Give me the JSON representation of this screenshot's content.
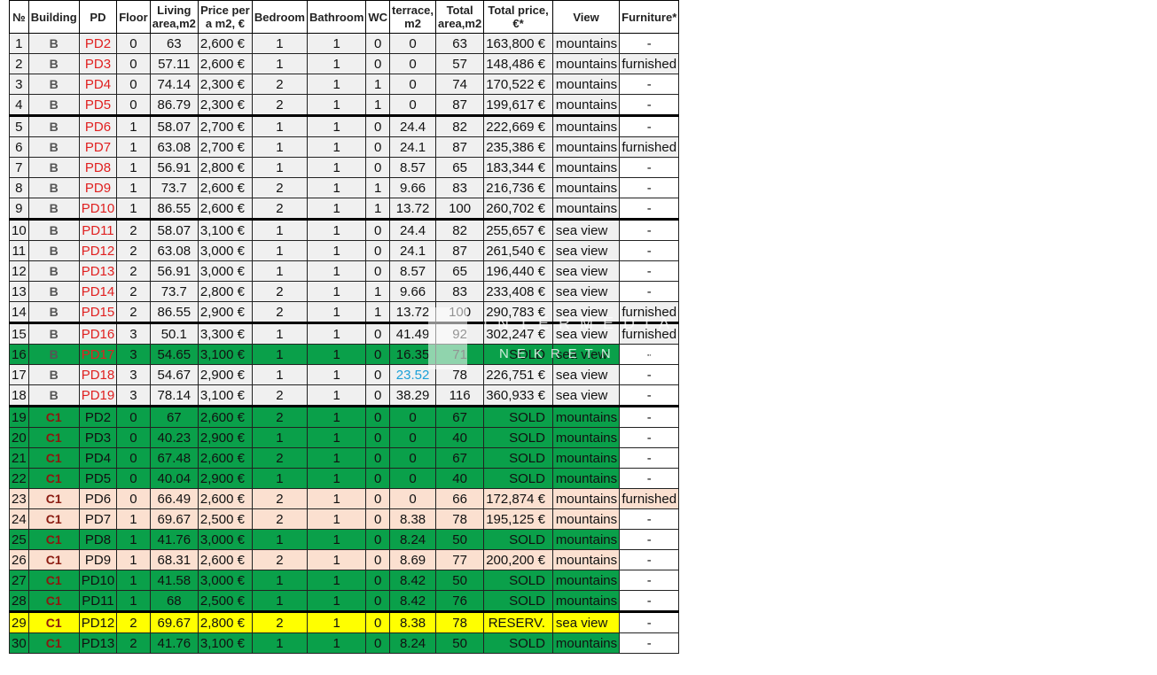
{
  "headers": [
    "№",
    "Building",
    "PD",
    "Floor",
    "Living area,m2",
    "Price per a m2, €",
    "Bedroom",
    "Bathroom",
    "WC",
    "terrace, m2",
    "Total area,m2",
    "Total price, €*",
    "View",
    "Furniture*"
  ],
  "watermark": {
    "line1": "INTERMEDIA",
    "line2": "NEKRETNINE"
  },
  "colors": {
    "sold_green": "#0aa04a",
    "reserved_yellow": "#ffff00",
    "furnished_orange": "#ffb31c",
    "peach": "#fbe0d0",
    "grey": "#f0f0f0",
    "pd_red": "#e02020",
    "terrace_blue": "#1aa0d8"
  },
  "rows": [
    {
      "no": "1",
      "building": "B",
      "pd": "PD2",
      "floor": "0",
      "living": "63",
      "ppm": "2,600 €",
      "bed": "1",
      "bath": "1",
      "wc": "0",
      "terrace": "0",
      "total_area": "63",
      "total_price": "163,800 €",
      "view": "mountains",
      "furniture": "-",
      "style": "grey",
      "pd_red": true,
      "furn_hi": false
    },
    {
      "no": "2",
      "building": "B",
      "pd": "PD3",
      "floor": "0",
      "living": "57.11",
      "ppm": "2,600 €",
      "bed": "1",
      "bath": "1",
      "wc": "0",
      "terrace": "0",
      "total_area": "57",
      "total_price": "148,486 €",
      "view": "mountains",
      "furniture": "furnished",
      "style": "grey",
      "pd_red": true,
      "furn_hi": true
    },
    {
      "no": "3",
      "building": "B",
      "pd": "PD4",
      "floor": "0",
      "living": "74.14",
      "ppm": "2,300 €",
      "bed": "2",
      "bath": "1",
      "wc": "1",
      "terrace": "0",
      "total_area": "74",
      "total_price": "170,522 €",
      "view": "mountains",
      "furniture": "-",
      "style": "grey",
      "pd_red": true,
      "furn_hi": false
    },
    {
      "no": "4",
      "building": "B",
      "pd": "PD5",
      "floor": "0",
      "living": "86.79",
      "ppm": "2,300 €",
      "bed": "2",
      "bath": "1",
      "wc": "1",
      "terrace": "0",
      "total_area": "87",
      "total_price": "199,617 €",
      "view": "mountains",
      "furniture": "-",
      "style": "grey",
      "pd_red": true,
      "furn_hi": false
    },
    {
      "no": "5",
      "building": "B",
      "pd": "PD6",
      "floor": "1",
      "living": "58.07",
      "ppm": "2,700 €",
      "bed": "1",
      "bath": "1",
      "wc": "0",
      "terrace": "24.4",
      "total_area": "82",
      "total_price": "222,669 €",
      "view": "mountains",
      "furniture": "-",
      "style": "grey",
      "pd_red": true,
      "furn_hi": false,
      "thick": true
    },
    {
      "no": "6",
      "building": "B",
      "pd": "PD7",
      "floor": "1",
      "living": "63.08",
      "ppm": "2,700 €",
      "bed": "1",
      "bath": "1",
      "wc": "0",
      "terrace": "24.1",
      "total_area": "87",
      "total_price": "235,386 €",
      "view": "mountains",
      "furniture": "furnished",
      "style": "grey",
      "pd_red": true,
      "furn_hi": true
    },
    {
      "no": "7",
      "building": "B",
      "pd": "PD8",
      "floor": "1",
      "living": "56.91",
      "ppm": "2,800 €",
      "bed": "1",
      "bath": "1",
      "wc": "0",
      "terrace": "8.57",
      "total_area": "65",
      "total_price": "183,344 €",
      "view": "mountains",
      "furniture": "-",
      "style": "grey",
      "pd_red": true,
      "furn_hi": false
    },
    {
      "no": "8",
      "building": "B",
      "pd": "PD9",
      "floor": "1",
      "living": "73.7",
      "ppm": "2,600 €",
      "bed": "2",
      "bath": "1",
      "wc": "1",
      "terrace": "9.66",
      "total_area": "83",
      "total_price": "216,736 €",
      "view": "mountains",
      "furniture": "-",
      "style": "grey",
      "pd_red": true,
      "furn_hi": false
    },
    {
      "no": "9",
      "building": "B",
      "pd": "PD10",
      "floor": "1",
      "living": "86.55",
      "ppm": "2,600 €",
      "bed": "2",
      "bath": "1",
      "wc": "1",
      "terrace": "13.72",
      "total_area": "100",
      "total_price": "260,702 €",
      "view": "mountains",
      "furniture": "-",
      "style": "grey",
      "pd_red": true,
      "furn_hi": false
    },
    {
      "no": "10",
      "building": "B",
      "pd": "PD11",
      "floor": "2",
      "living": "58.07",
      "ppm": "3,100 €",
      "bed": "1",
      "bath": "1",
      "wc": "0",
      "terrace": "24.4",
      "total_area": "82",
      "total_price": "255,657 €",
      "view": "sea view",
      "furniture": "-",
      "style": "grey",
      "pd_red": true,
      "furn_hi": false,
      "thick": true
    },
    {
      "no": "11",
      "building": "B",
      "pd": "PD12",
      "floor": "2",
      "living": "63.08",
      "ppm": "3,000 €",
      "bed": "1",
      "bath": "1",
      "wc": "0",
      "terrace": "24.1",
      "total_area": "87",
      "total_price": "261,540 €",
      "view": "sea view",
      "furniture": "-",
      "style": "grey",
      "pd_red": true,
      "furn_hi": false
    },
    {
      "no": "12",
      "building": "B",
      "pd": "PD13",
      "floor": "2",
      "living": "56.91",
      "ppm": "3,000 €",
      "bed": "1",
      "bath": "1",
      "wc": "0",
      "terrace": "8.57",
      "total_area": "65",
      "total_price": "196,440 €",
      "view": "sea view",
      "furniture": "-",
      "style": "grey",
      "pd_red": true,
      "furn_hi": false
    },
    {
      "no": "13",
      "building": "B",
      "pd": "PD14",
      "floor": "2",
      "living": "73.7",
      "ppm": "2,800 €",
      "bed": "2",
      "bath": "1",
      "wc": "1",
      "terrace": "9.66",
      "total_area": "83",
      "total_price": "233,408 €",
      "view": "sea view",
      "furniture": "-",
      "style": "grey",
      "pd_red": true,
      "furn_hi": false
    },
    {
      "no": "14",
      "building": "B",
      "pd": "PD15",
      "floor": "2",
      "living": "86.55",
      "ppm": "2,900 €",
      "bed": "2",
      "bath": "1",
      "wc": "1",
      "terrace": "13.72",
      "total_area": "100",
      "total_price": "290,783 €",
      "view": "sea view",
      "furniture": "furnished",
      "style": "grey",
      "pd_red": true,
      "furn_hi": true
    },
    {
      "no": "15",
      "building": "B",
      "pd": "PD16",
      "floor": "3",
      "living": "50.1",
      "ppm": "3,300 €",
      "bed": "1",
      "bath": "1",
      "wc": "0",
      "terrace": "41.49",
      "total_area": "92",
      "total_price": "302,247 €",
      "view": "sea view",
      "furniture": "furnished",
      "style": "grey",
      "pd_red": true,
      "furn_hi": true,
      "thick": true
    },
    {
      "no": "16",
      "building": "B",
      "pd": "PD17",
      "floor": "3",
      "living": "54.65",
      "ppm": "3,100 €",
      "bed": "1",
      "bath": "1",
      "wc": "0",
      "terrace": "16.35",
      "total_area": "71",
      "total_price": "SOLD",
      "view": "sea view",
      "furniture": "-",
      "style": "green",
      "pd_red": true,
      "furn_hi": false
    },
    {
      "no": "17",
      "building": "B",
      "pd": "PD18",
      "floor": "3",
      "living": "54.67",
      "ppm": "2,900 €",
      "bed": "1",
      "bath": "1",
      "wc": "0",
      "terrace": "23.52",
      "total_area": "78",
      "total_price": "226,751 €",
      "view": "sea view",
      "furniture": "-",
      "style": "grey",
      "pd_red": true,
      "furn_hi": false,
      "terrace_blue": true
    },
    {
      "no": "18",
      "building": "B",
      "pd": "PD19",
      "floor": "3",
      "living": "78.14",
      "ppm": "3,100 €",
      "bed": "2",
      "bath": "1",
      "wc": "0",
      "terrace": "38.29",
      "total_area": "116",
      "total_price": "360,933 €",
      "view": "sea view",
      "furniture": "-",
      "style": "grey",
      "pd_red": true,
      "furn_hi": false
    },
    {
      "no": "19",
      "building": "C1",
      "pd": "PD2",
      "floor": "0",
      "living": "67",
      "ppm": "2,600 €",
      "bed": "2",
      "bath": "1",
      "wc": "0",
      "terrace": "0",
      "total_area": "67",
      "total_price": "SOLD",
      "view": "mountains",
      "furniture": "-",
      "style": "green",
      "pd_red": false,
      "furn_hi": false,
      "thick": true
    },
    {
      "no": "20",
      "building": "C1",
      "pd": "PD3",
      "floor": "0",
      "living": "40.23",
      "ppm": "2,900 €",
      "bed": "1",
      "bath": "1",
      "wc": "0",
      "terrace": "0",
      "total_area": "40",
      "total_price": "SOLD",
      "view": "mountains",
      "furniture": "-",
      "style": "green",
      "pd_red": false,
      "furn_hi": false
    },
    {
      "no": "21",
      "building": "C1",
      "pd": "PD4",
      "floor": "0",
      "living": "67.48",
      "ppm": "2,600 €",
      "bed": "2",
      "bath": "1",
      "wc": "0",
      "terrace": "0",
      "total_area": "67",
      "total_price": "SOLD",
      "view": "mountains",
      "furniture": "-",
      "style": "green",
      "pd_red": false,
      "furn_hi": false
    },
    {
      "no": "22",
      "building": "C1",
      "pd": "PD5",
      "floor": "0",
      "living": "40.04",
      "ppm": "2,900 €",
      "bed": "1",
      "bath": "1",
      "wc": "0",
      "terrace": "0",
      "total_area": "40",
      "total_price": "SOLD",
      "view": "mountains",
      "furniture": "-",
      "style": "green",
      "pd_red": false,
      "furn_hi": false
    },
    {
      "no": "23",
      "building": "C1",
      "pd": "PD6",
      "floor": "0",
      "living": "66.49",
      "ppm": "2,600 €",
      "bed": "2",
      "bath": "1",
      "wc": "0",
      "terrace": "0",
      "total_area": "66",
      "total_price": "172,874 €",
      "view": "mountains",
      "furniture": "furnished",
      "style": "peach",
      "pd_red": false,
      "furn_hi": true
    },
    {
      "no": "24",
      "building": "C1",
      "pd": "PD7",
      "floor": "1",
      "living": "69.67",
      "ppm": "2,500 €",
      "bed": "2",
      "bath": "1",
      "wc": "0",
      "terrace": "8.38",
      "total_area": "78",
      "total_price": "195,125 €",
      "view": "mountains",
      "furniture": "-",
      "style": "peach",
      "pd_red": false,
      "furn_hi": false
    },
    {
      "no": "25",
      "building": "C1",
      "pd": "PD8",
      "floor": "1",
      "living": "41.76",
      "ppm": "3,000 €",
      "bed": "1",
      "bath": "1",
      "wc": "0",
      "terrace": "8.24",
      "total_area": "50",
      "total_price": "SOLD",
      "view": "mountains",
      "furniture": "-",
      "style": "green",
      "pd_red": false,
      "furn_hi": false
    },
    {
      "no": "26",
      "building": "C1",
      "pd": "PD9",
      "floor": "1",
      "living": "68.31",
      "ppm": "2,600 €",
      "bed": "2",
      "bath": "1",
      "wc": "0",
      "terrace": "8.69",
      "total_area": "77",
      "total_price": "200,200 €",
      "view": "mountains",
      "furniture": "-",
      "style": "peach",
      "pd_red": false,
      "furn_hi": false
    },
    {
      "no": "27",
      "building": "C1",
      "pd": "PD10",
      "floor": "1",
      "living": "41.58",
      "ppm": "3,000 €",
      "bed": "1",
      "bath": "1",
      "wc": "0",
      "terrace": "8.42",
      "total_area": "50",
      "total_price": "SOLD",
      "view": "mountains",
      "furniture": "-",
      "style": "green",
      "pd_red": false,
      "furn_hi": false
    },
    {
      "no": "28",
      "building": "C1",
      "pd": "PD11",
      "floor": "1",
      "living": "68",
      "ppm": "2,500 €",
      "bed": "1",
      "bath": "1",
      "wc": "0",
      "terrace": "8.42",
      "total_area": "76",
      "total_price": "SOLD",
      "view": "mountains",
      "furniture": "-",
      "style": "green",
      "pd_red": false,
      "furn_hi": false
    },
    {
      "no": "29",
      "building": "C1",
      "pd": "PD12",
      "floor": "2",
      "living": "69.67",
      "ppm": "2,800 €",
      "bed": "2",
      "bath": "1",
      "wc": "0",
      "terrace": "8.38",
      "total_area": "78",
      "total_price": "RESERV.",
      "view": "sea view",
      "furniture": "-",
      "style": "yellow",
      "pd_red": false,
      "furn_hi": false,
      "thick": true
    },
    {
      "no": "30",
      "building": "C1",
      "pd": "PD13",
      "floor": "2",
      "living": "41.76",
      "ppm": "3,100 €",
      "bed": "1",
      "bath": "1",
      "wc": "0",
      "terrace": "8.24",
      "total_area": "50",
      "total_price": "SOLD",
      "view": "mountains",
      "furniture": "-",
      "style": "green",
      "pd_red": false,
      "furn_hi": false
    }
  ]
}
